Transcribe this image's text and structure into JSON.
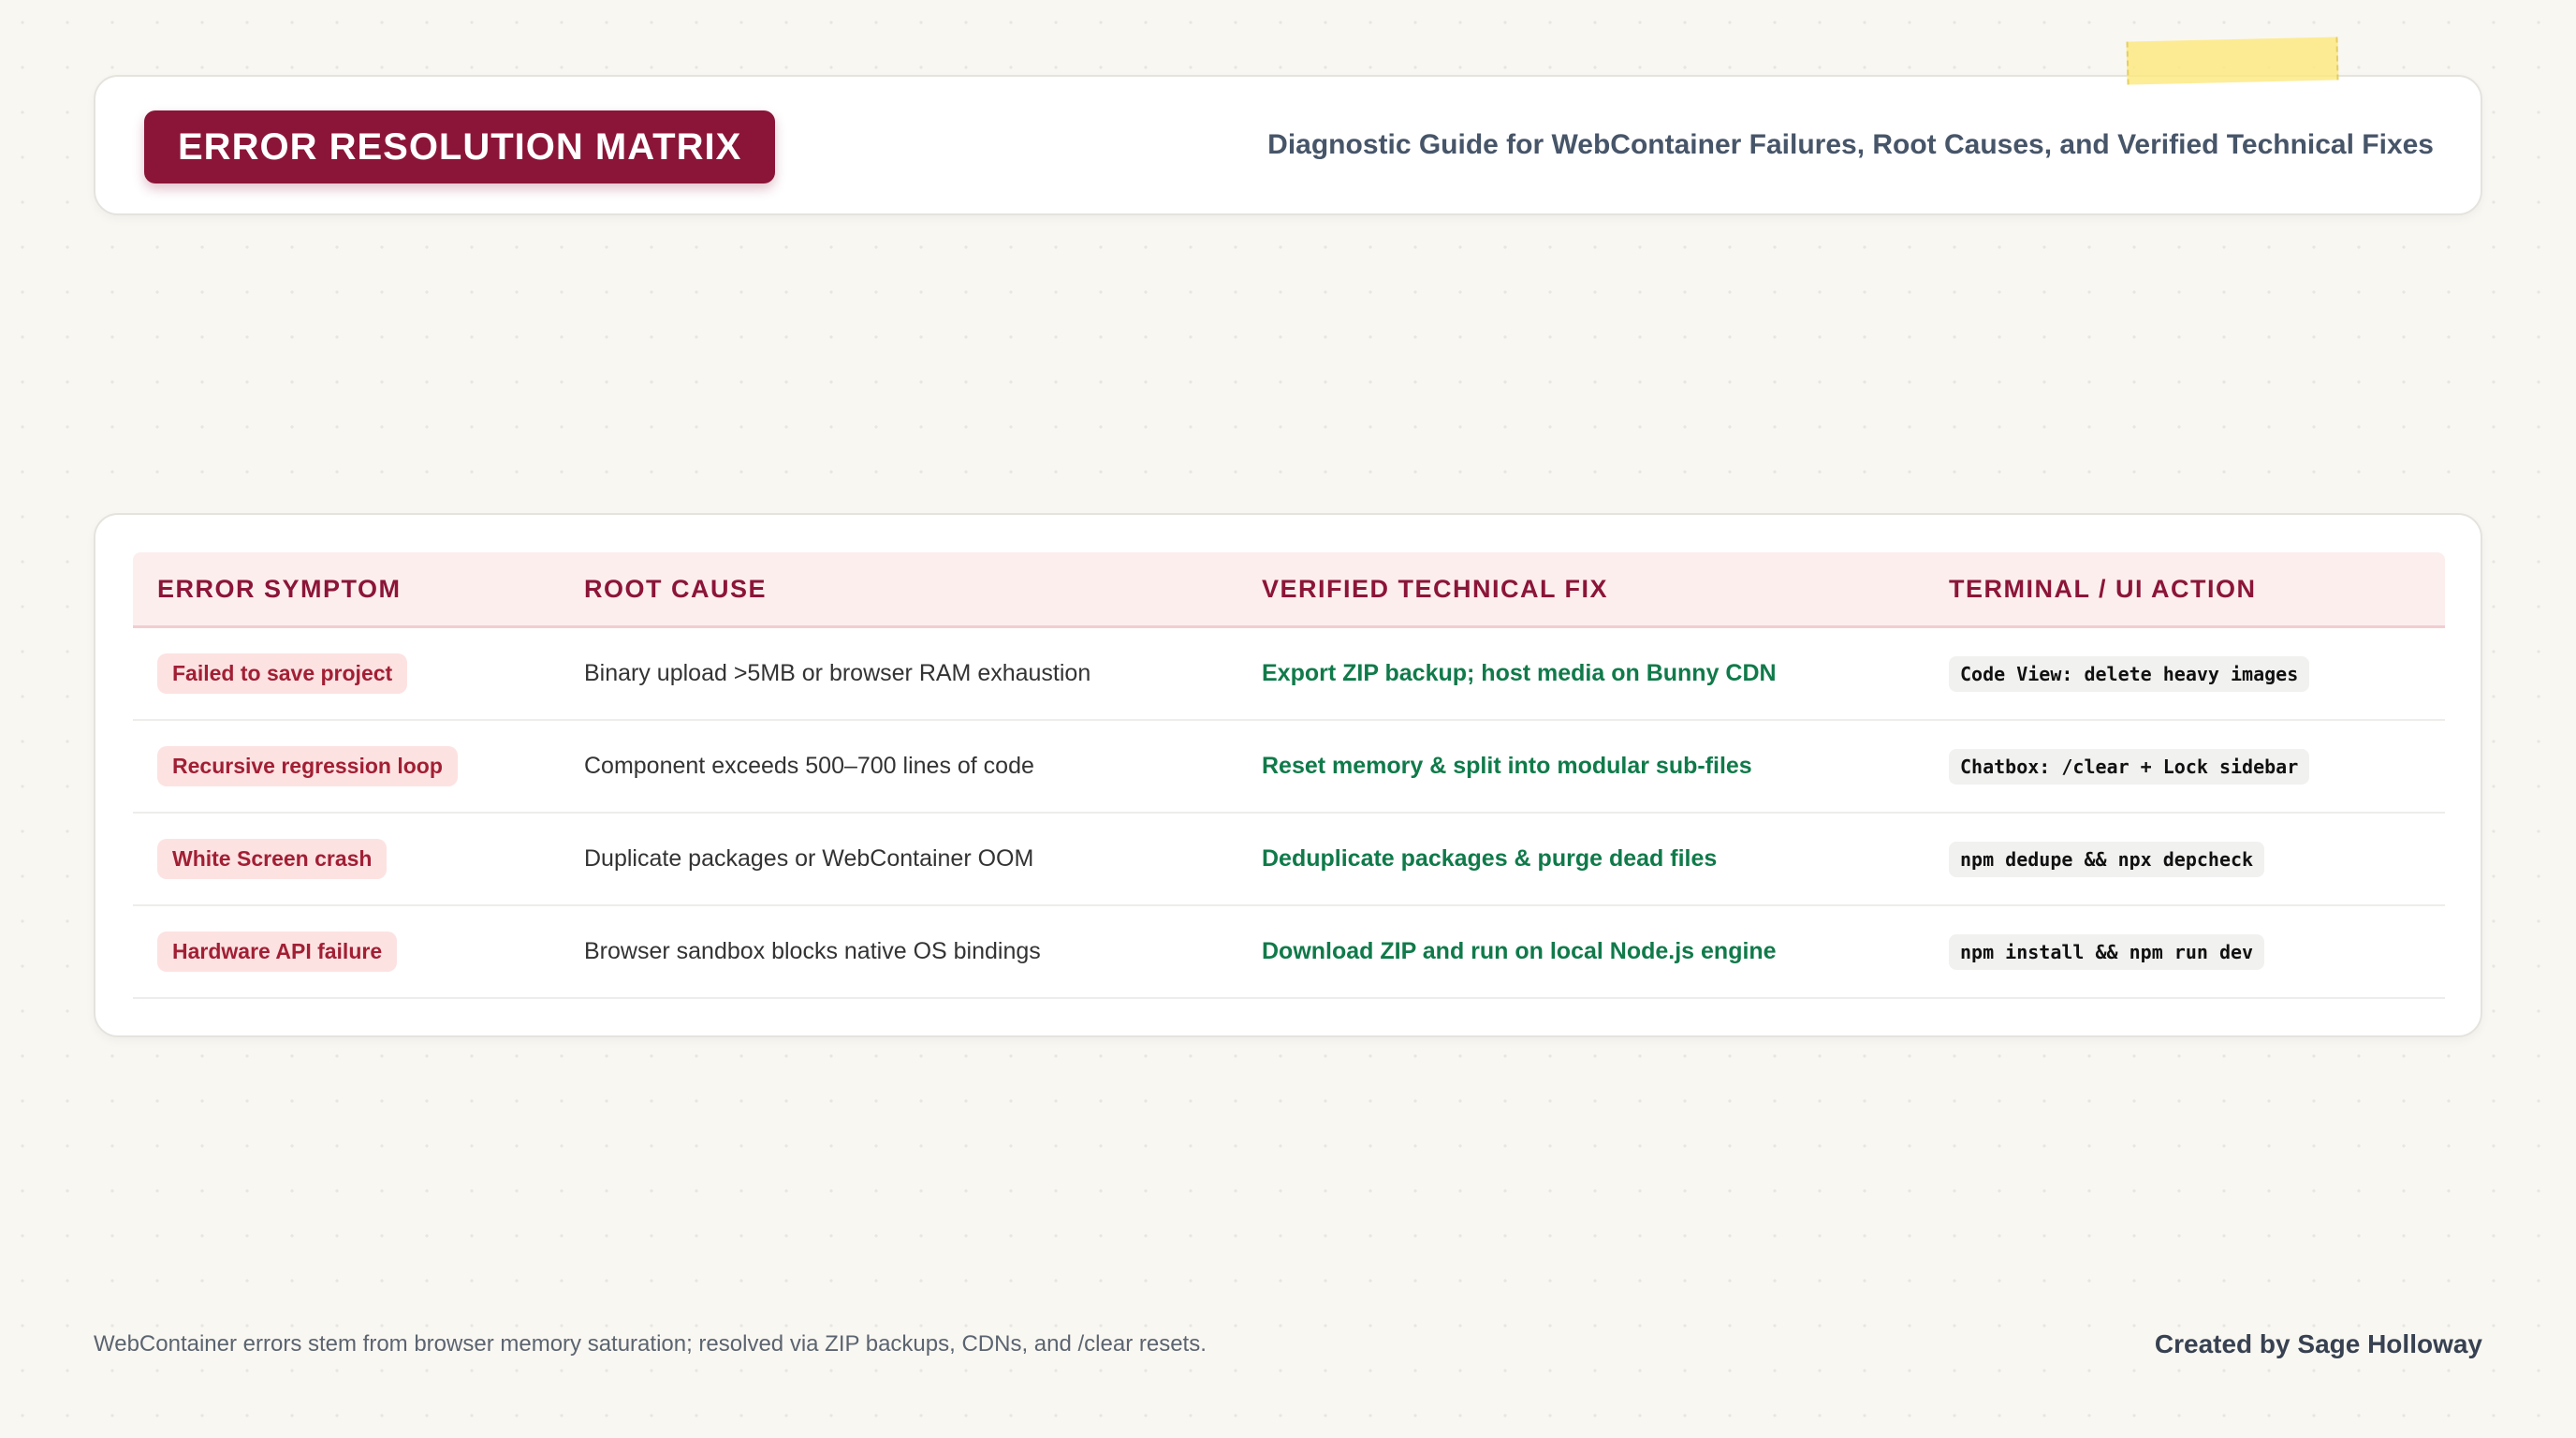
{
  "header": {
    "title": "ERROR RESOLUTION MATRIX",
    "subtitle": "Diagnostic Guide for WebContainer Failures, Root Causes, and Verified Technical Fixes"
  },
  "table": {
    "columns": [
      "ERROR SYMPTOM",
      "ROOT CAUSE",
      "VERIFIED TECHNICAL FIX",
      "TERMINAL / UI ACTION"
    ],
    "rows": [
      {
        "symptom": "Failed to save project",
        "cause": "Binary upload >5MB or browser RAM exhaustion",
        "fix": "Export ZIP backup; host media on Bunny CDN",
        "action": "Code View: delete heavy images"
      },
      {
        "symptom": "Recursive regression loop",
        "cause": "Component exceeds 500–700 lines of code",
        "fix": "Reset memory & split into modular sub-files",
        "action": "Chatbox: /clear + Lock sidebar"
      },
      {
        "symptom": "White Screen crash",
        "cause": "Duplicate packages or WebContainer OOM",
        "fix": "Deduplicate packages & purge dead files",
        "action": "npm dedupe && npx depcheck"
      },
      {
        "symptom": "Hardware API failure",
        "cause": "Browser sandbox blocks native OS bindings",
        "fix": "Download ZIP and run on local Node.js engine",
        "action": "npm install && npm run dev"
      }
    ]
  },
  "footer": {
    "note": "WebContainer errors stem from browser memory saturation; resolved via ZIP backups, CDNs, and /clear resets.",
    "credit": "Created by Sage Holloway"
  },
  "colors": {
    "accent": "#8b1538",
    "fix_text": "#107a4a",
    "symptom_bg": "#fde2e2",
    "header_bg": "#fdeeee",
    "page_bg": "#f9f7f2"
  }
}
